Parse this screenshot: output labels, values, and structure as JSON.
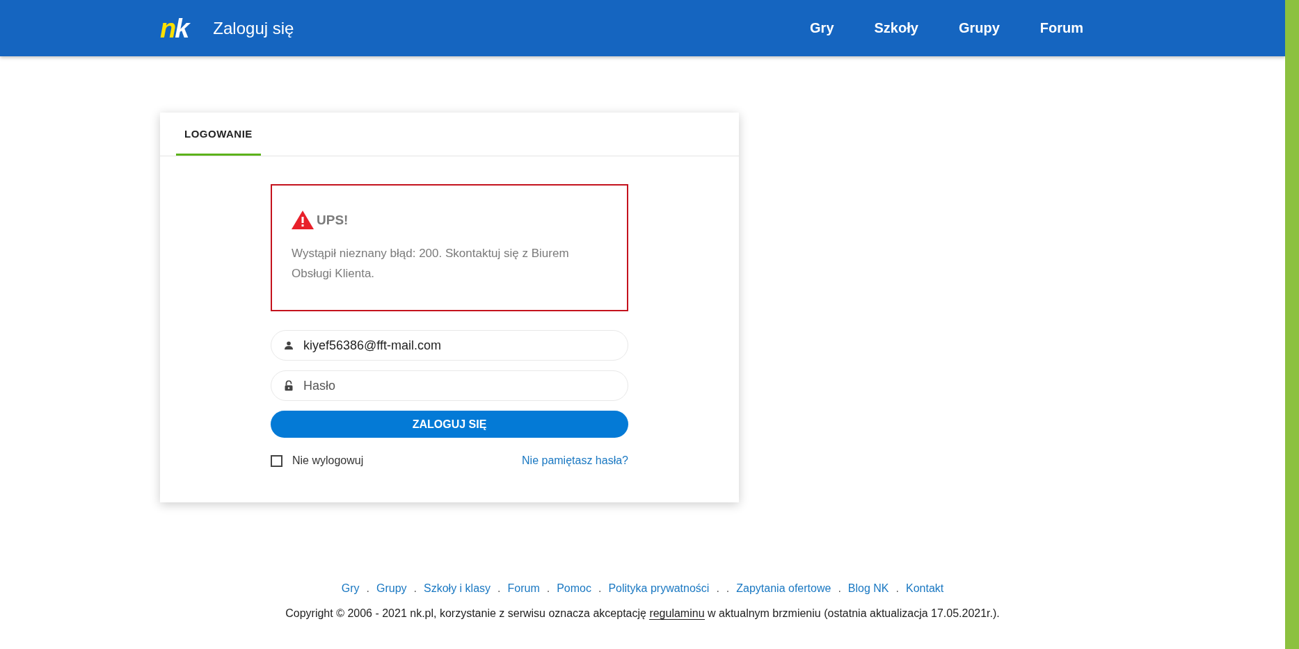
{
  "header": {
    "logo": {
      "letters": [
        "n",
        "k"
      ]
    },
    "title": "Zaloguj się",
    "nav": [
      {
        "label": "Gry"
      },
      {
        "label": "Szkoły"
      },
      {
        "label": "Grupy"
      },
      {
        "label": "Forum"
      }
    ]
  },
  "card": {
    "tabs": [
      {
        "label": "LOGOWANIE",
        "selected": true
      }
    ],
    "alert": {
      "title": "UPS!",
      "message": "Wystąpił nieznany błąd: 200. Skontaktuj się z Biurem Obsługi Klienta."
    },
    "email": {
      "value": "kiyef56386@fft-mail.com"
    },
    "password": {
      "placeholder": "Hasło"
    },
    "submit": "ZALOGUJ SIĘ",
    "remember": {
      "label": "Nie wylogowuj",
      "checked": false
    },
    "forgot": "Nie pamiętasz hasła?"
  },
  "footer": {
    "items": [
      {
        "kind": "link",
        "text": "Gry"
      },
      {
        "kind": "separator",
        "text": "."
      },
      {
        "kind": "link",
        "text": "Grupy"
      },
      {
        "kind": "separator",
        "text": "."
      },
      {
        "kind": "link",
        "text": "Szkoły i klasy"
      },
      {
        "kind": "separator",
        "text": "."
      },
      {
        "kind": "link",
        "text": "Forum"
      },
      {
        "kind": "separator",
        "text": "."
      },
      {
        "kind": "link",
        "text": "Pomoc"
      },
      {
        "kind": "separator",
        "text": "."
      },
      {
        "kind": "link",
        "text": "Polityka prywatności"
      },
      {
        "kind": "separator",
        "text": "."
      },
      {
        "kind": "separator",
        "text": "."
      },
      {
        "kind": "link",
        "text": "Zapytania ofertowe"
      },
      {
        "kind": "separator",
        "text": "."
      },
      {
        "kind": "link",
        "text": "Blog NK"
      },
      {
        "kind": "separator",
        "text": "."
      },
      {
        "kind": "link",
        "text": "Kontakt"
      }
    ],
    "copyright": {
      "before": "Copyright © 2006 - 2021 nk.pl, korzystanie z serwisu oznacza akceptację",
      "link": "regulaminu",
      "after": "w aktualnym brzmieniu (ostatnia aktualizacja 17.05.2021r.)."
    }
  }
}
